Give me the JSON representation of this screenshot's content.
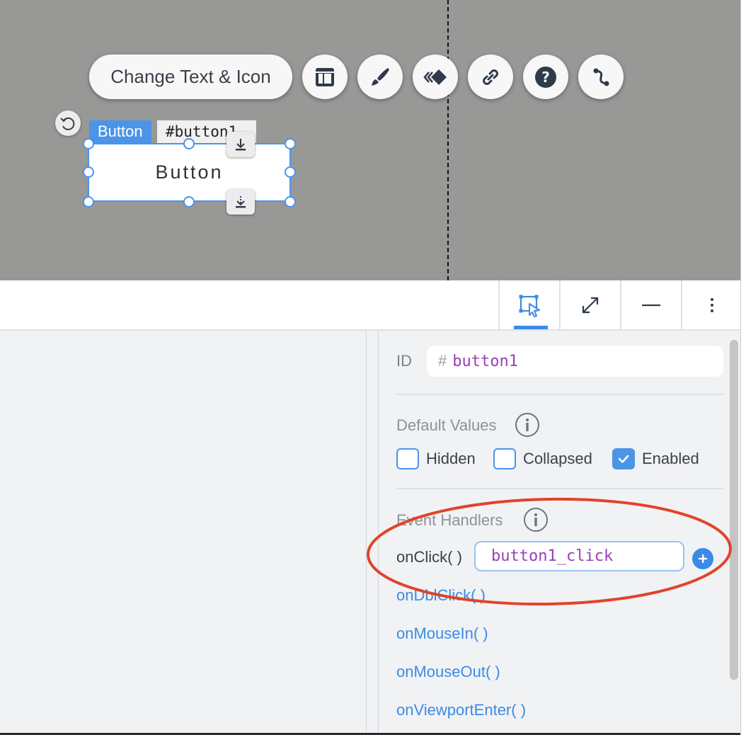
{
  "canvas": {
    "change_text_label": "Change Text & Icon",
    "element_type_tag": "Button",
    "element_id_tag": "#button1",
    "button_label": "Button"
  },
  "toolbar": {
    "icons": [
      "select-area-icon",
      "expand-icon",
      "minimize-icon",
      "more-options-icon"
    ]
  },
  "properties": {
    "id_label": "ID",
    "id_hash": "#",
    "id_value": "button1",
    "default_values_title": "Default Values",
    "checkboxes": [
      {
        "label": "Hidden",
        "checked": false
      },
      {
        "label": "Collapsed",
        "checked": false
      },
      {
        "label": "Enabled",
        "checked": true
      }
    ],
    "event_handlers_title": "Event Handlers",
    "on_click_label": "onClick( )",
    "on_click_value": "button1_click",
    "events": [
      "onDblClick( )",
      "onMouseIn( )",
      "onMouseOut( )",
      "onViewportEnter( )"
    ]
  },
  "colors": {
    "accent": "#3b8be6",
    "selection": "#4c94e8",
    "code": "#9b3fb8",
    "annotation": "#e0442a",
    "canvas_bg": "#989897"
  }
}
